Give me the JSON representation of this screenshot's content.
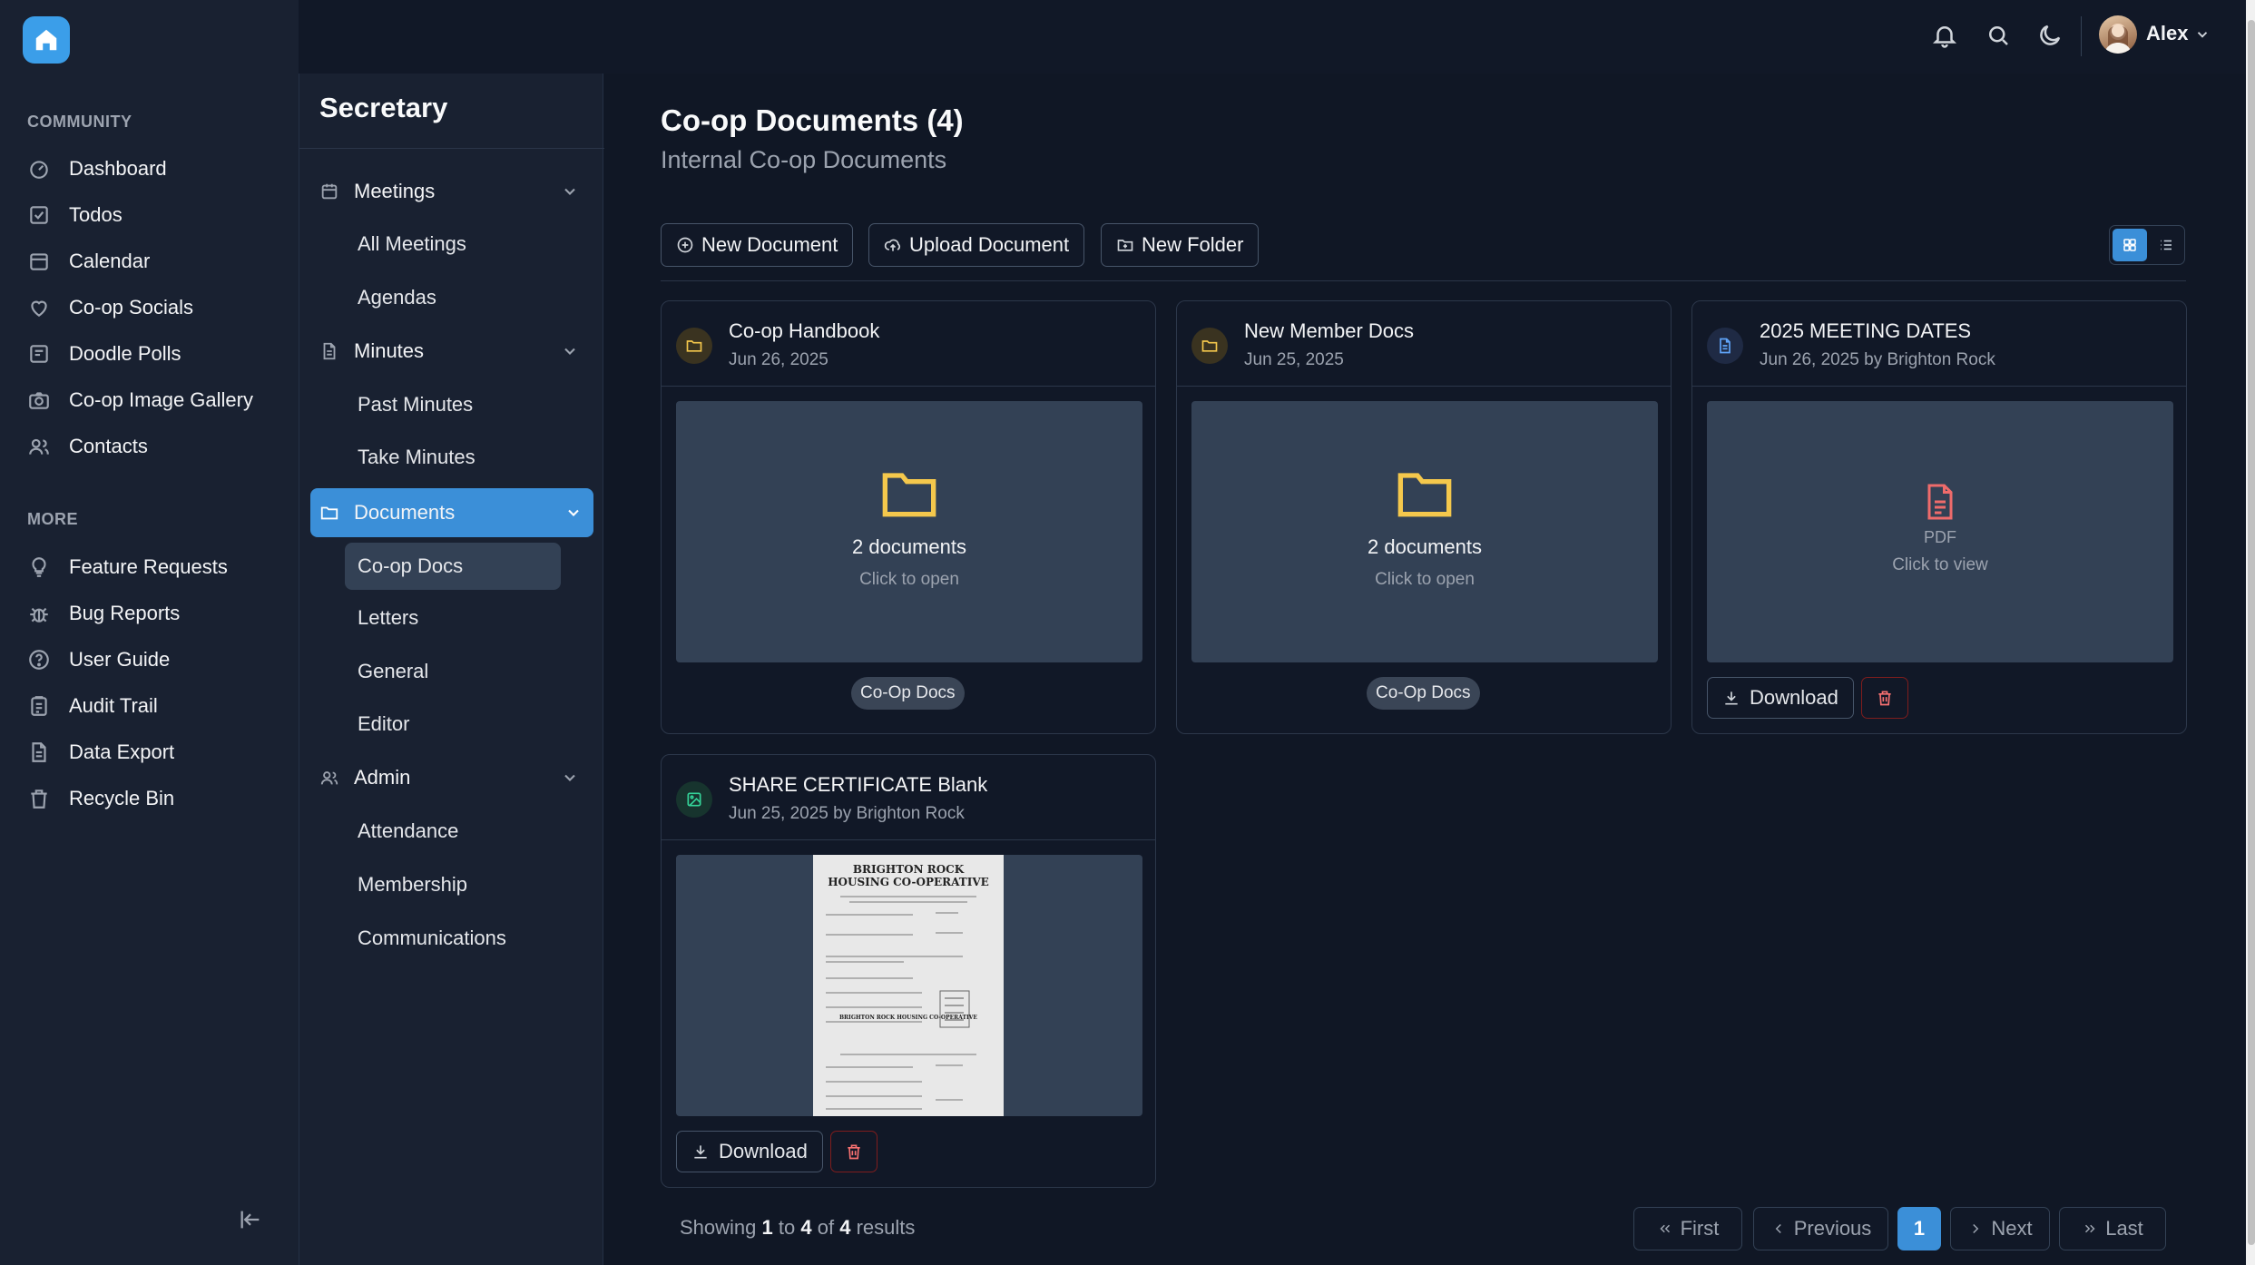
{
  "sidebar": {
    "sections": [
      {
        "title": "COMMUNITY",
        "items": [
          {
            "label": "Dashboard",
            "icon": "dashboard-icon"
          },
          {
            "label": "Todos",
            "icon": "checkbox-icon"
          },
          {
            "label": "Calendar",
            "icon": "calendar-icon"
          },
          {
            "label": "Co-op Socials",
            "icon": "heart-icon"
          },
          {
            "label": "Doodle Polls",
            "icon": "poll-icon"
          },
          {
            "label": "Co-op Image Gallery",
            "icon": "camera-icon"
          },
          {
            "label": "Contacts",
            "icon": "users-icon"
          }
        ]
      },
      {
        "title": "MORE",
        "items": [
          {
            "label": "Feature Requests",
            "icon": "lightbulb-icon"
          },
          {
            "label": "Bug Reports",
            "icon": "bug-icon"
          },
          {
            "label": "User Guide",
            "icon": "help-icon"
          },
          {
            "label": "Audit Trail",
            "icon": "audit-icon"
          },
          {
            "label": "Data Export",
            "icon": "file-export-icon"
          },
          {
            "label": "Recycle Bin",
            "icon": "trash-icon"
          }
        ]
      }
    ]
  },
  "topbar": {
    "user_name": "Alex"
  },
  "subnav": {
    "title": "Secretary",
    "groups": [
      {
        "label": "Meetings",
        "items": [
          "All Meetings",
          "Agendas"
        ]
      },
      {
        "label": "Minutes",
        "items": [
          "Past Minutes",
          "Take Minutes"
        ]
      },
      {
        "label": "Documents",
        "items": [
          "Co-op Docs",
          "Letters",
          "General",
          "Editor"
        ]
      },
      {
        "label": "Admin",
        "items": [
          "Attendance",
          "Membership",
          "Communications"
        ]
      }
    ]
  },
  "main": {
    "title": "Co-op Documents (4)",
    "subtitle": "Internal Co-op Documents",
    "buttons": {
      "new_document": "New Document",
      "upload_document": "Upload Document",
      "new_folder": "New Folder"
    },
    "cards": [
      {
        "title": "Co-op Handbook",
        "date": "Jun 26, 2025",
        "count": "2 documents",
        "hint": "Click to open",
        "tag": "Co-Op Docs"
      },
      {
        "title": "New Member Docs",
        "date": "Jun 25, 2025",
        "count": "2 documents",
        "hint": "Click to open",
        "tag": "Co-Op Docs"
      },
      {
        "title": "2025 MEETING DATES",
        "date": "Jun 26, 2025 by Brighton Rock",
        "file_type": "PDF",
        "hint": "Click to view",
        "download": "Download"
      },
      {
        "title": "SHARE CERTIFICATE Blank",
        "date": "Jun 25, 2025 by Brighton Rock",
        "download": "Download",
        "doc_heading_1": "BRIGHTON ROCK",
        "doc_heading_2": "HOUSING CO-OPERATIVE",
        "doc_heading_3": "BRIGHTON ROCK HOUSING CO-OPERATIVE"
      }
    ],
    "footer": {
      "prefix": "Showing",
      "from": "1",
      "to_word": "to",
      "to": "4",
      "of_word": "of",
      "total": "4",
      "suffix": "results"
    },
    "pagination": {
      "first": "First",
      "previous": "Previous",
      "current": "1",
      "next": "Next",
      "last": "Last"
    }
  },
  "colors": {
    "accent": "#3b8fd8",
    "folder": "#f5c84c",
    "pdf": "#ef6b6b",
    "image": "#34d399"
  }
}
